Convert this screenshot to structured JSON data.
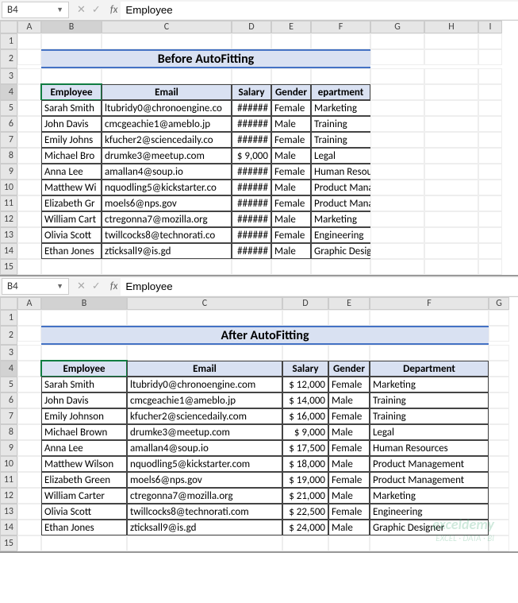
{
  "activeCell": "B4",
  "formulaValue": "Employee",
  "title1": "Before AutoFitting",
  "title2": "After AutoFitting",
  "headers": {
    "employee": "Employee",
    "email": "Email",
    "salary": "Salary",
    "gender": "Gender",
    "department_trunc": "epartment",
    "department": "Department"
  },
  "cols1": [
    "A",
    "B",
    "C",
    "D",
    "E",
    "F",
    "G",
    "H",
    "I"
  ],
  "cols2": [
    "A",
    "B",
    "C",
    "D",
    "E",
    "F",
    "G"
  ],
  "rows1": [
    "1",
    "2",
    "3",
    "4",
    "5",
    "6",
    "7",
    "8",
    "9",
    "10",
    "11",
    "12",
    "13",
    "14",
    "15"
  ],
  "rows2": [
    "1",
    "2",
    "3",
    "4",
    "5",
    "6",
    "7",
    "8",
    "9",
    "10",
    "11",
    "12",
    "13",
    "14",
    "15"
  ],
  "chart_data": {
    "type": "table",
    "columns": [
      "Employee",
      "Email",
      "Salary",
      "Gender",
      "Department"
    ],
    "rows": [
      {
        "employee": "Sarah Smith",
        "email": "ltubridy0@chronoengine.com",
        "salary": 12000,
        "gender": "Female",
        "department": "Marketing"
      },
      {
        "employee": "John Davis",
        "email": "cmcgeachie1@ameblo.jp",
        "salary": 14000,
        "gender": "Male",
        "department": "Training"
      },
      {
        "employee": "Emily Johnson",
        "email": "kfucher2@sciencedaily.com",
        "salary": 16000,
        "gender": "Female",
        "department": "Training"
      },
      {
        "employee": "Michael Brown",
        "email": "drumke3@meetup.com",
        "salary": 9000,
        "gender": "Male",
        "department": "Legal"
      },
      {
        "employee": "Anna Lee",
        "email": "amallan4@soup.io",
        "salary": 17500,
        "gender": "Female",
        "department": "Human Resources"
      },
      {
        "employee": "Matthew Wilson",
        "email": "nquodling5@kickstarter.com",
        "salary": 18000,
        "gender": "Male",
        "department": "Product Management"
      },
      {
        "employee": "Elizabeth Green",
        "email": "moels6@nps.gov",
        "salary": 19000,
        "gender": "Female",
        "department": "Product Management"
      },
      {
        "employee": "William Carter",
        "email": "ctregonna7@mozilla.org",
        "salary": 21000,
        "gender": "Male",
        "department": "Marketing"
      },
      {
        "employee": "Olivia Scott",
        "email": "twillcocks8@technorati.com",
        "salary": 22500,
        "gender": "Female",
        "department": "Engineering"
      },
      {
        "employee": "Ethan Jones",
        "email": "zticksall9@is.gd",
        "salary": 24000,
        "gender": "Male",
        "department": "Graphic Designer"
      }
    ]
  },
  "before_display": [
    {
      "emp": "Sarah Smith",
      "email": "ltubridy0@chronoengine.co",
      "sal": "######",
      "gen": "Female",
      "dep": "Marketing"
    },
    {
      "emp": "John Davis",
      "email": "cmcgeachie1@ameblo.jp",
      "sal": "######",
      "gen": "Male",
      "dep": "Training"
    },
    {
      "emp": "Emily Johns",
      "email": "kfucher2@sciencedaily.co",
      "sal": "######",
      "gen": "Female",
      "dep": "Training"
    },
    {
      "emp": "Michael Bro",
      "email": "drumke3@meetup.com",
      "sal": "$  9,000",
      "gen": "Male",
      "dep": "Legal"
    },
    {
      "emp": "Anna Lee",
      "email": "amallan4@soup.io",
      "sal": "######",
      "gen": "Female",
      "dep": "Human Resources"
    },
    {
      "emp": "Matthew Wi",
      "email": "nquodling5@kickstarter.co",
      "sal": "######",
      "gen": "Male",
      "dep": "Product Management"
    },
    {
      "emp": "Elizabeth Gr",
      "email": "moels6@nps.gov",
      "sal": "######",
      "gen": "Female",
      "dep": "Product Management"
    },
    {
      "emp": "William Cart",
      "email": "ctregonna7@mozilla.org",
      "sal": "######",
      "gen": "Male",
      "dep": "Marketing"
    },
    {
      "emp": "Olivia Scott",
      "email": "twillcocks8@technorati.co",
      "sal": "######",
      "gen": "Female",
      "dep": "Engineering"
    },
    {
      "emp": "Ethan Jones",
      "email": "zticksall9@is.gd",
      "sal": "######",
      "gen": "Male",
      "dep": "Graphic Designer"
    }
  ],
  "after_display": [
    {
      "emp": "Sarah Smith",
      "email": "ltubridy0@chronoengine.com",
      "sal": "$ 12,000",
      "gen": "Female",
      "dep": "Marketing"
    },
    {
      "emp": "John Davis",
      "email": "cmcgeachie1@ameblo.jp",
      "sal": "$ 14,000",
      "gen": "Male",
      "dep": "Training"
    },
    {
      "emp": "Emily Johnson",
      "email": "kfucher2@sciencedaily.com",
      "sal": "$ 16,000",
      "gen": "Female",
      "dep": "Training"
    },
    {
      "emp": "Michael Brown",
      "email": "drumke3@meetup.com",
      "sal": "$   9,000",
      "gen": "Male",
      "dep": "Legal"
    },
    {
      "emp": "Anna Lee",
      "email": "amallan4@soup.io",
      "sal": "$ 17,500",
      "gen": "Female",
      "dep": "Human Resources"
    },
    {
      "emp": "Matthew Wilson",
      "email": "nquodling5@kickstarter.com",
      "sal": "$ 18,000",
      "gen": "Male",
      "dep": "Product Management"
    },
    {
      "emp": "Elizabeth Green",
      "email": "moels6@nps.gov",
      "sal": "$ 19,000",
      "gen": "Female",
      "dep": "Product Management"
    },
    {
      "emp": "William Carter",
      "email": "ctregonna7@mozilla.org",
      "sal": "$ 21,000",
      "gen": "Male",
      "dep": "Marketing"
    },
    {
      "emp": "Olivia Scott",
      "email": "twillcocks8@technorati.com",
      "sal": "$ 22,500",
      "gen": "Female",
      "dep": "Engineering"
    },
    {
      "emp": "Ethan Jones",
      "email": "zticksall9@is.gd",
      "sal": "$ 24,000",
      "gen": "Male",
      "dep": "Graphic Designer"
    }
  ],
  "watermark": {
    "line1": "exceldemy",
    "line2": "EXCEL · DATA · BI"
  }
}
